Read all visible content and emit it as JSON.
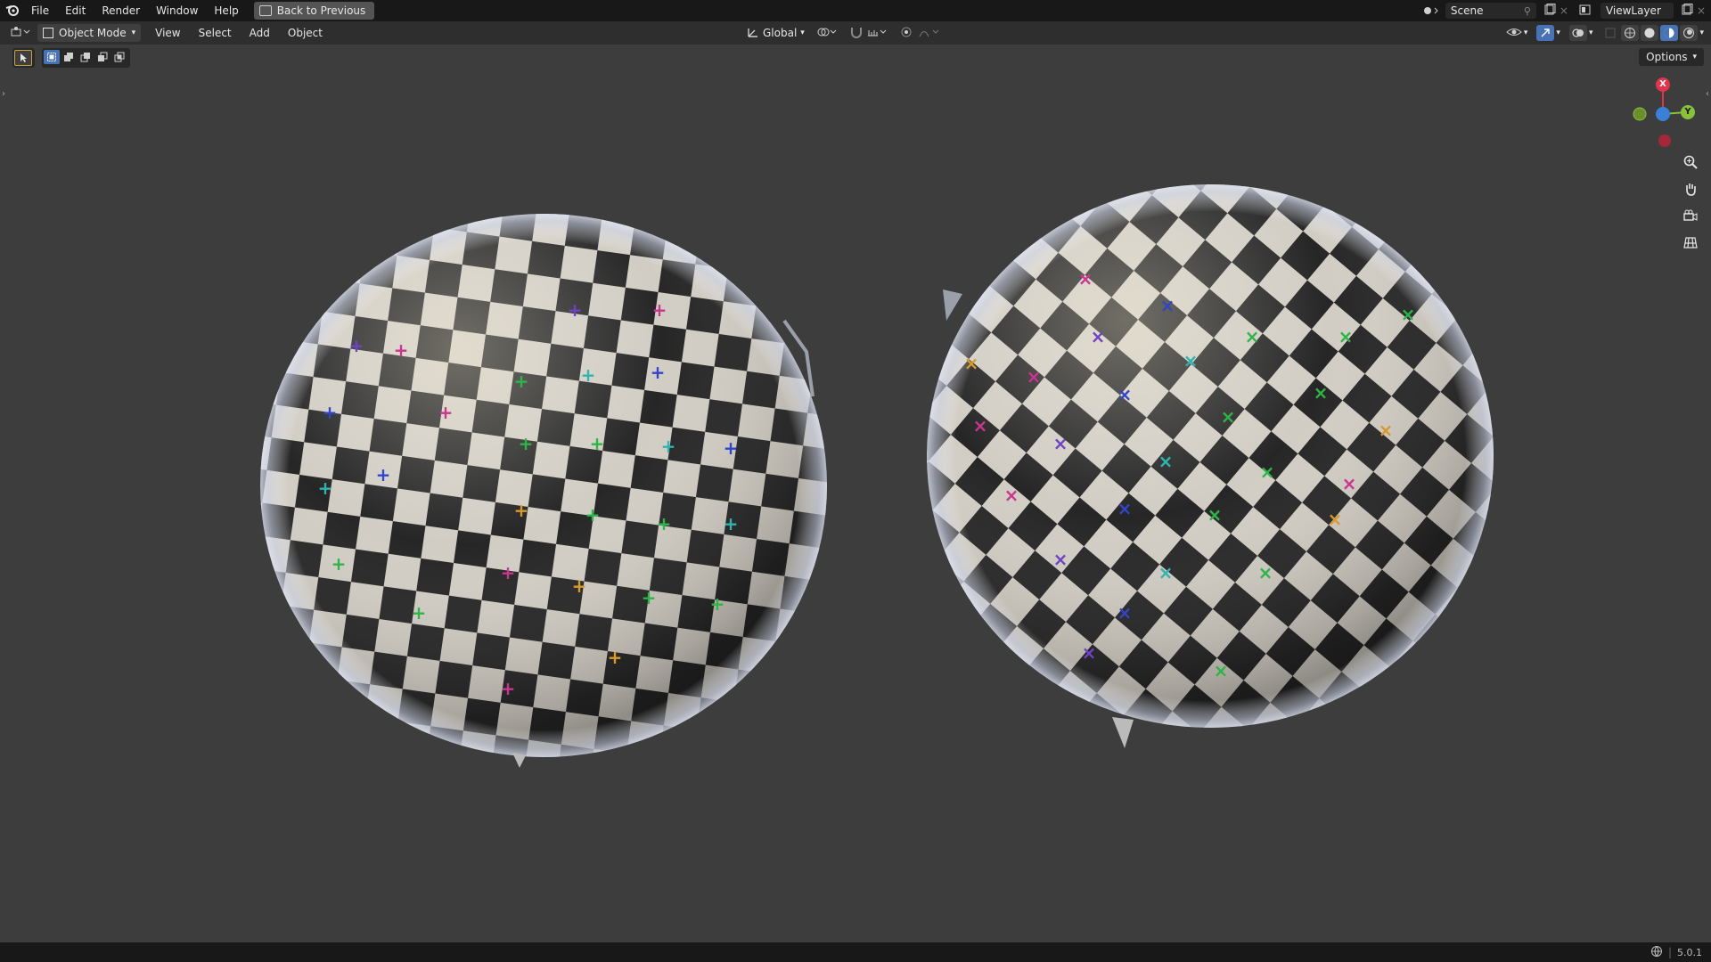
{
  "topbar": {
    "menu": [
      "File",
      "Edit",
      "Render",
      "Window",
      "Help"
    ],
    "back_button": "Back to Previous",
    "scene": "Scene",
    "view_layer": "ViewLayer"
  },
  "header": {
    "mode": "Object Mode",
    "menu": [
      "View",
      "Select",
      "Add",
      "Object"
    ],
    "transform_orientation": "Global",
    "options_label": "Options"
  },
  "gizmo": {
    "x_label": "X",
    "y_label": "Y",
    "colors": {
      "x": "#e0344b",
      "y": "#88c13a",
      "z": "#3b80d6"
    }
  },
  "status": {
    "version": "5.0.1"
  },
  "icons": [
    "blender-logo-icon",
    "editor-type-icon",
    "select-tool-icon",
    "zoom-icon",
    "hand-pan-icon",
    "camera-icon",
    "grid-icon"
  ]
}
